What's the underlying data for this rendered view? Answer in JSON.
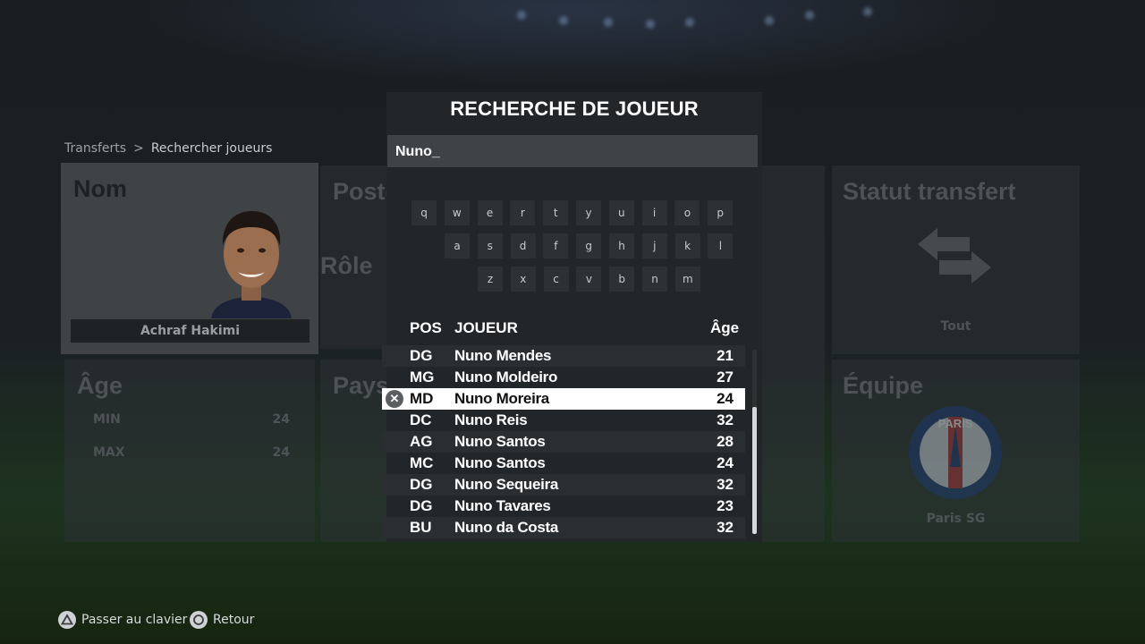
{
  "breadcrumb": {
    "parent": "Transferts",
    "separator": ">",
    "current": "Rechercher joueurs"
  },
  "filters": {
    "nom": {
      "title": "Nom",
      "player_name": "Achraf Hakimi"
    },
    "poste": {
      "title": "Poste"
    },
    "role": {
      "title": "Rôle"
    },
    "pays": {
      "title": "Pays"
    },
    "age": {
      "title": "Âge",
      "min_label": "MIN",
      "min_value": "24",
      "max_label": "MAX",
      "max_value": "24"
    },
    "statut": {
      "title": "Statut transfert",
      "value": "Tout",
      "icon": "transfer-arrows-icon"
    },
    "equipe": {
      "title": "Équipe",
      "team": "Paris SG",
      "icon": "psg-crest-icon"
    }
  },
  "modal": {
    "title": "RECHERCHE DE JOUEUR",
    "search_value": "Nuno_",
    "keyboard": {
      "row1": [
        "q",
        "w",
        "e",
        "r",
        "t",
        "y",
        "u",
        "i",
        "o",
        "p"
      ],
      "row2": [
        "a",
        "s",
        "d",
        "f",
        "g",
        "h",
        "j",
        "k",
        "l"
      ],
      "row3": [
        "z",
        "x",
        "c",
        "v",
        "b",
        "n",
        "m"
      ]
    },
    "columns": {
      "pos": "POS",
      "player": "JOUEUR",
      "age": "Âge"
    },
    "results": [
      {
        "pos": "DG",
        "name": "Nuno Mendes",
        "age": "21"
      },
      {
        "pos": "MG",
        "name": "Nuno Moldeiro",
        "age": "27"
      },
      {
        "pos": "MD",
        "name": "Nuno Moreira",
        "age": "24",
        "selected": true
      },
      {
        "pos": "DC",
        "name": "Nuno Reis",
        "age": "32"
      },
      {
        "pos": "AG",
        "name": "Nuno Santos",
        "age": "28"
      },
      {
        "pos": "MC",
        "name": "Nuno Santos",
        "age": "24"
      },
      {
        "pos": "DG",
        "name": "Nuno Sequeira",
        "age": "32"
      },
      {
        "pos": "DG",
        "name": "Nuno Tavares",
        "age": "23"
      },
      {
        "pos": "BU",
        "name": "Nuno da Costa",
        "age": "32"
      }
    ],
    "selected_button_icon": "cross-button-icon"
  },
  "footer": {
    "hint1": {
      "icon": "triangle-button-icon",
      "label": "Passer au clavier"
    },
    "hint2": {
      "icon": "circle-button-icon",
      "label": "Retour"
    }
  },
  "colors": {
    "highlight_row": "#ffffff",
    "modal_bg": "#232629"
  }
}
